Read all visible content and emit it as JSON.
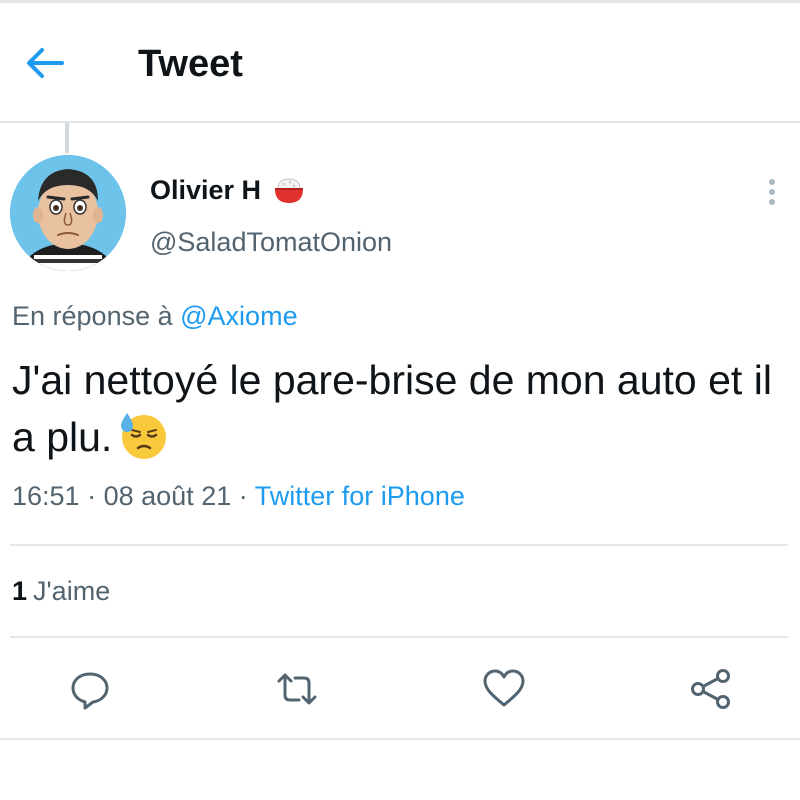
{
  "header": {
    "title": "Tweet",
    "back_icon": "arrow-left-icon"
  },
  "tweet": {
    "author": {
      "display_name": "Olivier H",
      "name_emoji": "rice-bowl-icon",
      "handle": "@SaladTomatOnion"
    },
    "reply_prefix": "En réponse à",
    "reply_to": "@Axiome",
    "text": "J'ai nettoyé le pare-brise de mon auto et il a plu.",
    "text_emoji": "downcast-face-with-sweat-icon",
    "time": "16:51",
    "dot1": "·",
    "date": "08 août 21",
    "dot2": "·",
    "source": "Twitter for iPhone",
    "likes": {
      "count": "1",
      "label": "J'aime"
    }
  },
  "actions": [
    "reply-icon",
    "retweet-icon",
    "like-icon",
    "share-icon"
  ],
  "colors": {
    "accent": "#1d9bf0",
    "text": "#0f1419",
    "secondary": "#536471",
    "divider": "#e3e7ea"
  }
}
